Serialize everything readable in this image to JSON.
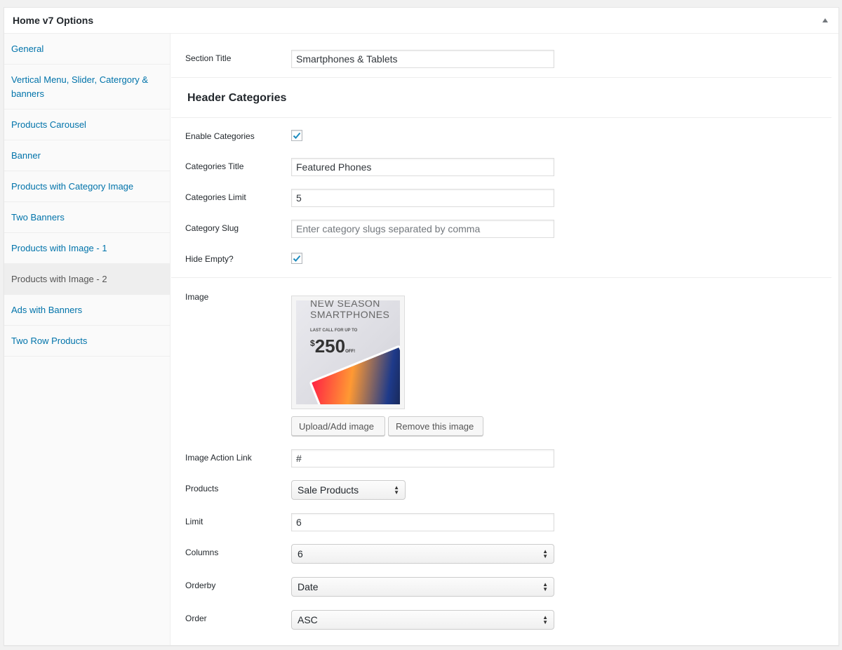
{
  "panel": {
    "title": "Home v7 Options"
  },
  "sidebar": {
    "items": [
      {
        "label": "General"
      },
      {
        "label": "Vertical Menu, Slider, Catergory & banners"
      },
      {
        "label": "Products Carousel"
      },
      {
        "label": "Banner"
      },
      {
        "label": "Products with Category Image"
      },
      {
        "label": "Two Banners"
      },
      {
        "label": "Products with Image - 1"
      },
      {
        "label": "Products with Image - 2",
        "active": true
      },
      {
        "label": "Ads with Banners"
      },
      {
        "label": "Two Row Products"
      }
    ]
  },
  "form": {
    "section_title_label": "Section Title",
    "section_title_value": "Smartphones & Tablets",
    "header_categories_heading": "Header Categories",
    "enable_categories_label": "Enable Categories",
    "enable_categories_checked": true,
    "categories_title_label": "Categories Title",
    "categories_title_value": "Featured Phones",
    "categories_limit_label": "Categories Limit",
    "categories_limit_value": "5",
    "category_slug_label": "Category Slug",
    "category_slug_placeholder": "Enter category slugs separated by comma",
    "hide_empty_label": "Hide Empty?",
    "hide_empty_checked": true,
    "image_label": "Image",
    "image_preview": {
      "line1": "NEW SEASON",
      "line2": "SMARTPHONES",
      "line3": "LAST CALL FOR UP TO",
      "currency": "$",
      "amount": "250",
      "suffix": "OFF!"
    },
    "upload_button": "Upload/Add image",
    "remove_button": "Remove this image",
    "image_action_link_label": "Image Action Link",
    "image_action_link_value": "#",
    "products_label": "Products",
    "products_value": "Sale Products",
    "limit_label": "Limit",
    "limit_value": "6",
    "columns_label": "Columns",
    "columns_value": "6",
    "orderby_label": "Orderby",
    "orderby_value": "Date",
    "order_label": "Order",
    "order_value": "ASC"
  },
  "colors": {
    "link": "#0073aa",
    "checkmark": "#1e8cbe"
  }
}
